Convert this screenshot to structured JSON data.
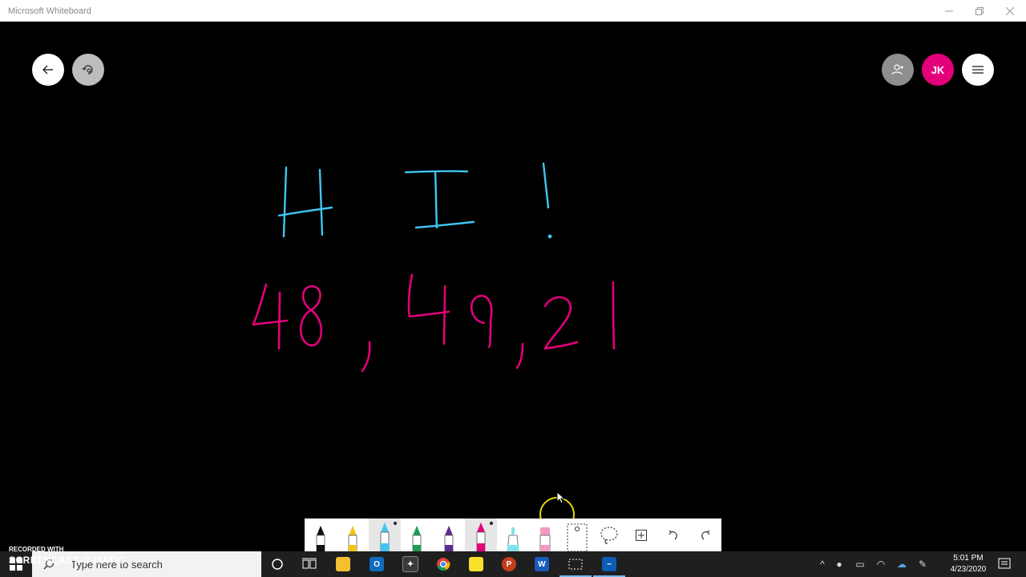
{
  "window": {
    "title": "Microsoft Whiteboard",
    "controls": [
      "minimize",
      "restore",
      "close"
    ]
  },
  "header": {
    "back_icon": "arrow-left-icon",
    "ink_replay_icon": "ink-replay-icon",
    "invite_icon": "person-add-icon",
    "avatar_initials": "JK",
    "menu_icon": "hamburger-icon"
  },
  "colors": {
    "accent": "#e3007a",
    "ink_blue": "#3fc7f4",
    "ink_pink": "#e3007a",
    "toolbar_bg": "#ffffff",
    "canvas_bg": "#000000",
    "cursor_ring": "#e8d800"
  },
  "board": {
    "ink_text_line1": "H I !",
    "ink_text_line2": "48, 49, 21"
  },
  "toolbar": {
    "tools": [
      {
        "name": "black-pen",
        "color": "#111111"
      },
      {
        "name": "yellow-pen",
        "color": "#f2c417"
      },
      {
        "name": "blue-pen",
        "color": "#3fc7f4",
        "selected": true
      },
      {
        "name": "green-pen",
        "color": "#1d9e57"
      },
      {
        "name": "purple-pen",
        "color": "#5b2d90"
      },
      {
        "name": "pink-pen",
        "color": "#e3007a",
        "selected": true
      },
      {
        "name": "highlighter",
        "color": "#7fe3ec"
      },
      {
        "name": "eraser",
        "color": "#f29ac0"
      },
      {
        "name": "ruler-icon"
      },
      {
        "name": "lasso-icon"
      },
      {
        "name": "add-icon"
      },
      {
        "name": "undo-icon"
      },
      {
        "name": "redo-icon"
      }
    ]
  },
  "taskbar": {
    "search_placeholder": "Type here to search",
    "apps": [
      "cortana-icon",
      "task-view-icon",
      "file-explorer-icon",
      "outlook-icon",
      "app-icon",
      "chrome-icon",
      "sticky-notes-icon",
      "powerpoint-icon",
      "word-icon",
      "snip-icon",
      "whiteboard-icon"
    ],
    "time": "5:01 PM",
    "date": "4/23/2020"
  },
  "watermark": {
    "line1": "RECORDED WITH",
    "line2": "SCREENCAST-O-MATIC"
  }
}
